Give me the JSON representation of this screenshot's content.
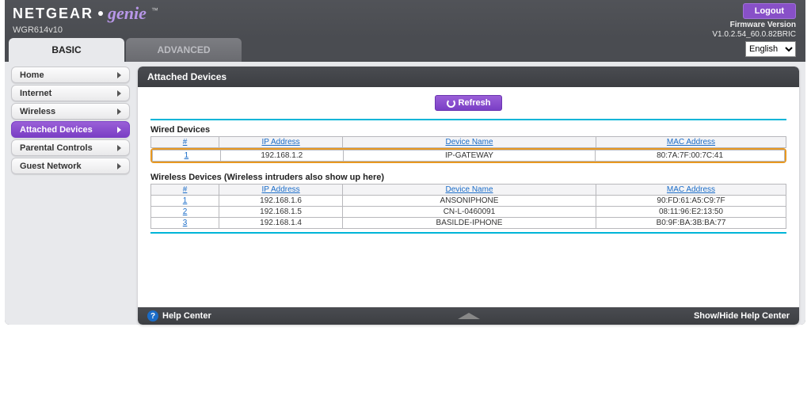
{
  "brand": {
    "netgear": "NETGEAR",
    "genie": "genie",
    "tm": "™"
  },
  "model": "WGR614v10",
  "logout": "Logout",
  "firmware": {
    "label": "Firmware Version",
    "value": "V1.0.2.54_60.0.82BRIC"
  },
  "tabs": {
    "basic": "BASIC",
    "advanced": "ADVANCED"
  },
  "language": {
    "selected": "English"
  },
  "nav": [
    {
      "label": "Home"
    },
    {
      "label": "Internet"
    },
    {
      "label": "Wireless"
    },
    {
      "label": "Attached Devices",
      "active": true
    },
    {
      "label": "Parental Controls"
    },
    {
      "label": "Guest Network"
    }
  ],
  "panel_title": "Attached Devices",
  "refresh_label": "Refresh",
  "wired": {
    "title": "Wired Devices",
    "headers": {
      "num": "#",
      "ip": "IP Address",
      "name": "Device Name",
      "mac": "MAC Address"
    },
    "rows": [
      {
        "num": "1",
        "ip": "192.168.1.2",
        "name": "IP-GATEWAY",
        "mac": "80:7A:7F:00:7C:41"
      }
    ]
  },
  "wireless": {
    "title": "Wireless Devices (Wireless intruders also show up here)",
    "headers": {
      "num": "#",
      "ip": "IP Address",
      "name": "Device Name",
      "mac": "MAC Address"
    },
    "rows": [
      {
        "num": "1",
        "ip": "192.168.1.6",
        "name": "ANSONIPHONE",
        "mac": "90:FD:61:A5:C9:7F"
      },
      {
        "num": "2",
        "ip": "192.168.1.5",
        "name": "CN-L-0460091",
        "mac": "08:11:96:E2:13:50"
      },
      {
        "num": "3",
        "ip": "192.168.1.4",
        "name": "BASILDE-IPHONE",
        "mac": "B0:9F:BA:3B:BA:77"
      }
    ]
  },
  "footer": {
    "help_center": "Help Center",
    "show_hide": "Show/Hide Help Center"
  }
}
